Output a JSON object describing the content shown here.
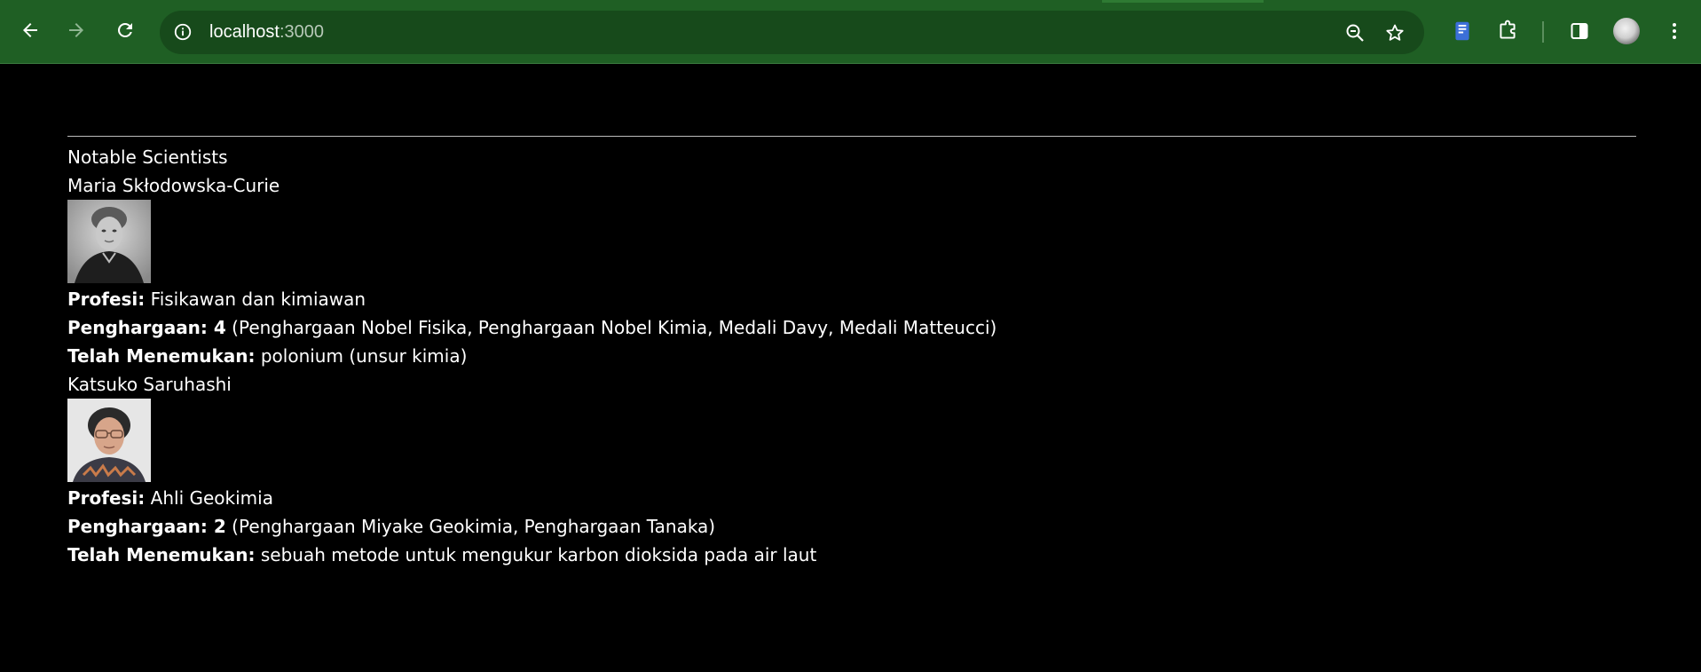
{
  "browser": {
    "url_host": "localhost",
    "url_port": ":3000",
    "icons": {
      "back": "back-arrow-icon",
      "forward": "forward-arrow-icon",
      "reload": "reload-icon",
      "site_info": "info-icon",
      "zoom": "zoom-out-icon",
      "bookmark": "star-icon",
      "reading_list": "reading-list-icon",
      "extensions": "puzzle-icon",
      "side_panel": "side-panel-icon",
      "profile": "avatar",
      "menu": "kebab-menu-icon"
    },
    "colors": {
      "toolbar": "#1f5f24",
      "omnibox": "#174a1b",
      "accent_blue": "#3b6fd8"
    }
  },
  "page": {
    "heading": "Notable Scientists",
    "scientists": [
      {
        "name": "Maria Skłodowska-Curie",
        "profession_label": "Profesi:",
        "profession": "Fisikawan dan kimiawan",
        "awards_label": "Penghargaan: 4",
        "awards": "(Penghargaan Nobel Fisika, Penghargaan Nobel Kimia, Medali Davy, Medali Matteucci)",
        "discovery_label": "Telah Menemukan:",
        "discovery": "polonium (unsur kimia)"
      },
      {
        "name": "Katsuko Saruhashi",
        "profession_label": "Profesi:",
        "profession": "Ahli Geokimia",
        "awards_label": "Penghargaan: 2",
        "awards": "(Penghargaan Miyake Geokimia, Penghargaan Tanaka)",
        "discovery_label": "Telah Menemukan:",
        "discovery": "sebuah metode untuk mengukur karbon dioksida pada air laut"
      }
    ]
  }
}
